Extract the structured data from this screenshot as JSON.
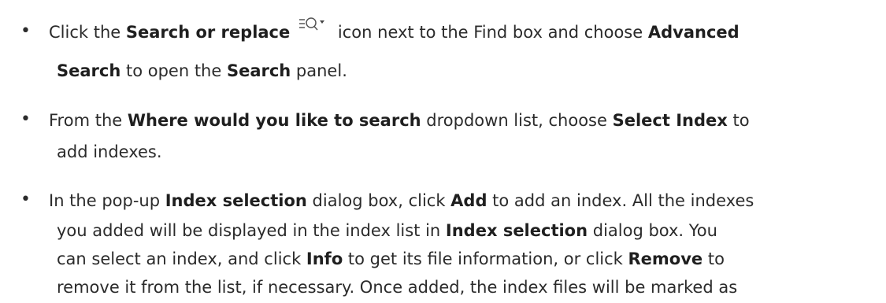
{
  "bullet_char": "•",
  "item1": {
    "t1": "Click the ",
    "b1": "Search or replace",
    "icon": "search-replace-icon",
    "t2": " icon next to the Find box and choose ",
    "b2": "Advanced",
    "b3": "Search",
    "t3": " to open the ",
    "b4": "Search",
    "t4": " panel."
  },
  "item2": {
    "t1": "From the ",
    "b1": "Where would you like to search",
    "t2": " dropdown list, choose ",
    "b2": "Select Index",
    "t3": " to",
    "t4": "add indexes."
  },
  "item3": {
    "t1": "In the pop-up ",
    "b1": "Index selection",
    "t2": " dialog box, click ",
    "b2": "Add",
    "t3": " to add an index. All the indexes",
    "t4": "you added will be displayed in the index list in ",
    "b3": "Index selection",
    "t5": " dialog box. You",
    "t6": "can select an index, and click ",
    "b4": "Info",
    "t7": " to get its file information, or click ",
    "b5": "Remove",
    "t8": " to",
    "t9": "remove it from the list, if necessary. Once added, the index files will be marked as"
  }
}
